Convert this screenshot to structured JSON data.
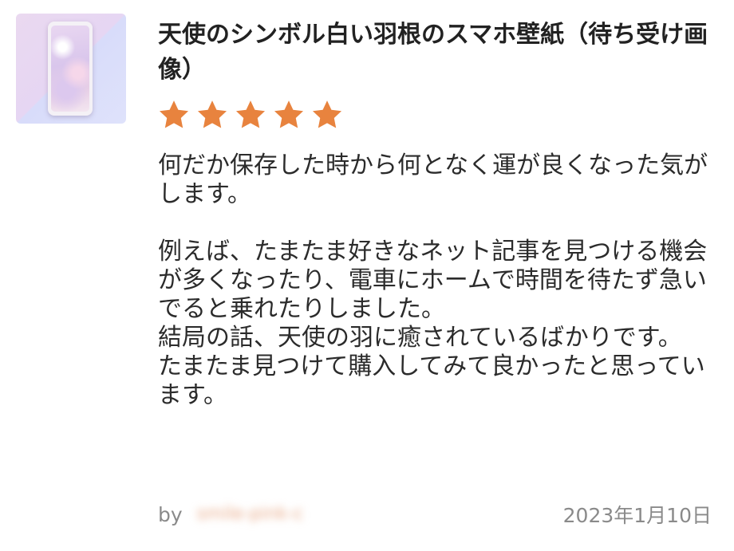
{
  "product": {
    "thumbnail_alt": "phone-wallpaper-thumbnail",
    "title": "天使のシンボル白い羽根のスマホ壁紙（待ち受け画像）"
  },
  "rating": {
    "stars": 5,
    "max": 5,
    "color": "#E8833E"
  },
  "review": {
    "paragraphs": [
      "何だか保存した時から何となく運が良くなった気がします。",
      "",
      "例えば、たまたま好きなネット記事を見つける機会が多くなったり、電車にホームで時間を待たず急いでると乗れたりしました。",
      "結局の話、天使の羽に癒されているばかりです。",
      "たまたま見つけて購入してみて良かったと思っています。"
    ]
  },
  "footer": {
    "by_label": "by",
    "author": "smile-pink-c",
    "date": "2023年1月10日"
  }
}
